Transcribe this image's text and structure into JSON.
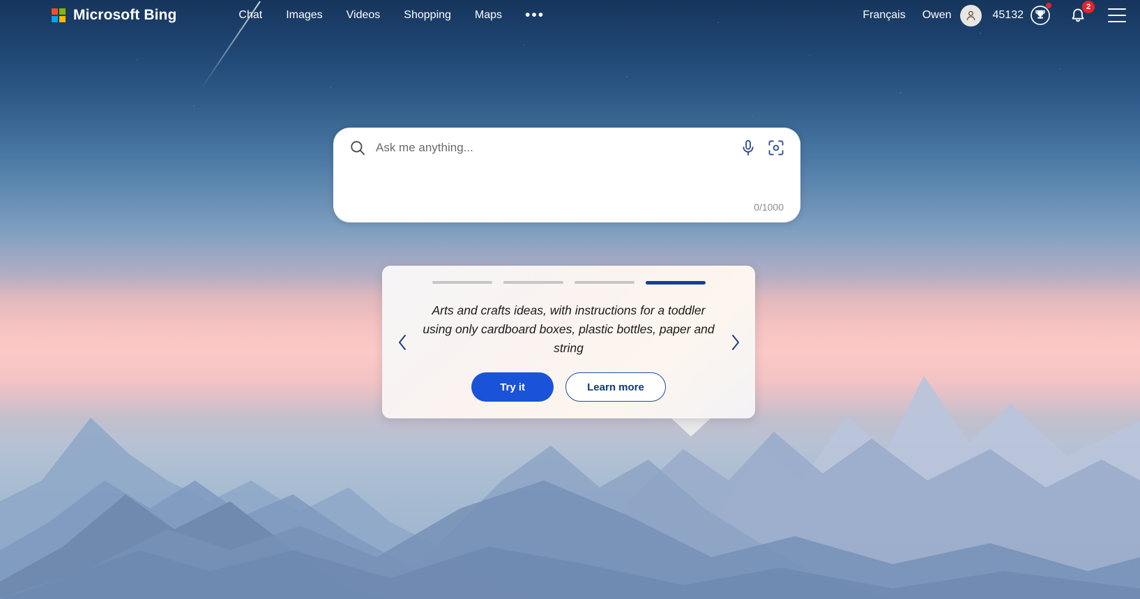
{
  "brand": {
    "name": "Microsoft Bing",
    "logo_icon": "microsoft-logo-icon",
    "colors": {
      "red": "#f25022",
      "green": "#7fba00",
      "blue": "#00a4ef",
      "yellow": "#ffb900"
    }
  },
  "nav": {
    "items": [
      {
        "label": "Chat"
      },
      {
        "label": "Images"
      },
      {
        "label": "Videos"
      },
      {
        "label": "Shopping"
      },
      {
        "label": "Maps"
      }
    ],
    "overflow_label": "•••",
    "overflow_icon": "more-horizontal-icon"
  },
  "account": {
    "language": "Français",
    "username": "Owen",
    "avatar_icon": "person-avatar-icon",
    "rewards_points": "45132",
    "rewards_icon": "rewards-trophy-icon",
    "rewards_has_alert": true,
    "notifications_icon": "bell-icon",
    "notifications_count": "2",
    "menu_icon": "hamburger-menu-icon"
  },
  "search": {
    "placeholder": "Ask me anything...",
    "value": "",
    "search_icon": "search-magnifier-icon",
    "mic_icon": "microphone-icon",
    "visual_search_icon": "visual-search-camera-icon",
    "counter": "0/1000",
    "max_chars": "1000"
  },
  "suggestion_card": {
    "text": "Arts and crafts ideas, with instructions for a toddler using only cardboard boxes, plastic bottles, paper and string",
    "prev_icon": "chevron-left-icon",
    "next_icon": "chevron-right-icon",
    "slides_total": 4,
    "active_slide": 4,
    "primary_button": "Try it",
    "secondary_button": "Learn more",
    "accent_color": "#153f96",
    "primary_button_color": "#1a53d8"
  }
}
